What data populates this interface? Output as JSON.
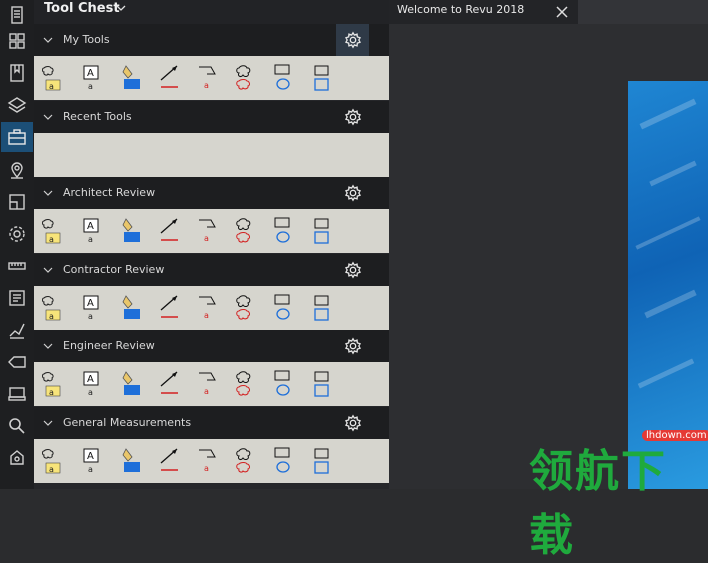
{
  "panel": {
    "title": "Tool Chest"
  },
  "sections": [
    {
      "name": "my-tools",
      "label": "My Tools",
      "gear_highlight": true,
      "tools": [
        "callout-1",
        "textbox-2",
        "highlight-3",
        "arrow-4",
        "callout-5",
        "cloud-6",
        "ellipse-7",
        "rectangle-8"
      ]
    },
    {
      "name": "recent-tools",
      "label": "Recent Tools",
      "tools": []
    },
    {
      "name": "architect-review",
      "label": "Architect Review",
      "tools": [
        "cloud-callout",
        "text-box",
        "highlight",
        "arrow",
        "stamp",
        "cloud",
        "callout",
        "dimension"
      ]
    },
    {
      "name": "contractor-review",
      "label": "Contractor Review",
      "tools": [
        "cloud-callout",
        "text-box",
        "highlight",
        "area-measure",
        "stamp",
        "cloud",
        "callout",
        "checkmark"
      ]
    },
    {
      "name": "engineer-review",
      "label": "Engineer Review",
      "tools": [
        "cloud-callout",
        "text-box",
        "highlight",
        "length-measure",
        "stamp",
        "cloud",
        "callout",
        "polylength"
      ]
    },
    {
      "name": "general-measurements",
      "label": "General Measurements",
      "tools": [
        "length",
        "polylength",
        "area",
        "volume",
        "diameter",
        "count",
        "angle",
        "radius"
      ]
    }
  ],
  "tab": {
    "label": "Welcome to Revu 2018"
  },
  "watermark": {
    "text": "领航下载",
    "url": "lhdown.com"
  },
  "colors": {
    "accent": "#1c4f77",
    "panel_bg": "#26272a",
    "tool_bg": "#d6d5ce",
    "watermark_green": "#1faa3d"
  }
}
